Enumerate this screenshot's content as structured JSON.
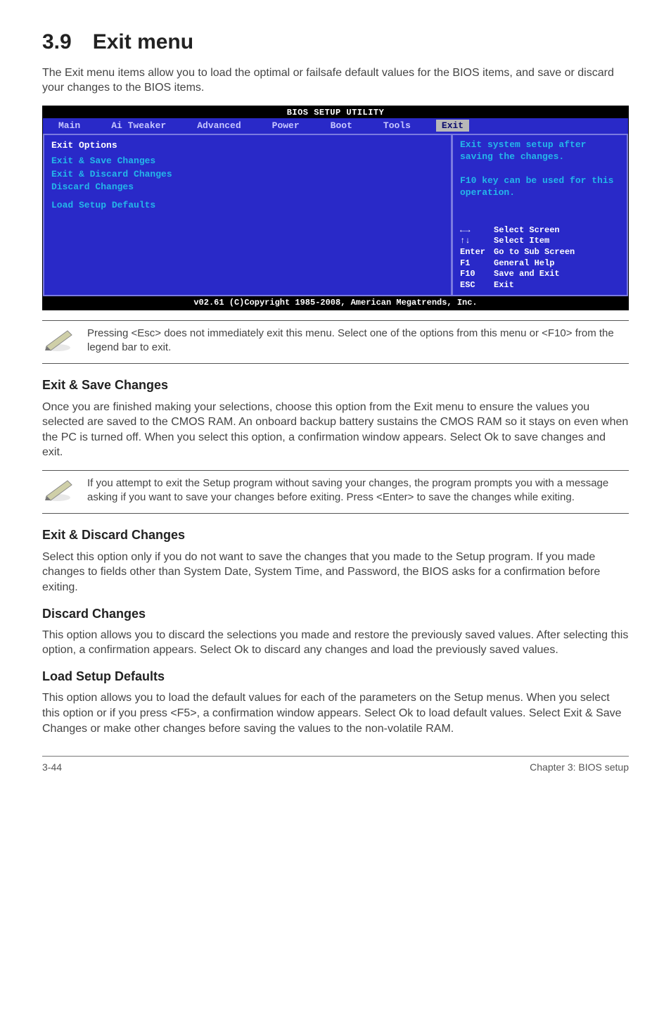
{
  "section": {
    "number": "3.9",
    "title": "Exit menu"
  },
  "intro": "The Exit menu items allow you to load the optimal or failsafe default values for the BIOS items, and save or discard your changes to the BIOS items.",
  "bios": {
    "title": "BIOS SETUP UTILITY",
    "tabs": [
      "Main",
      "Ai Tweaker",
      "Advanced",
      "Power",
      "Boot",
      "Tools",
      "Exit"
    ],
    "active_tab": "Exit",
    "options_header": "Exit Options",
    "options": [
      "Exit & Save Changes",
      "Exit & Discard Changes",
      "Discard Changes",
      "Load Setup Defaults"
    ],
    "help": "Exit system setup after saving the changes.\n\nF10 key can be used for this operation.",
    "keys": [
      {
        "k": "←→",
        "d": "Select Screen"
      },
      {
        "k": "↑↓",
        "d": "Select Item"
      },
      {
        "k": "Enter",
        "d": "Go to Sub Screen"
      },
      {
        "k": "F1",
        "d": "General Help"
      },
      {
        "k": "F10",
        "d": "Save and Exit"
      },
      {
        "k": "ESC",
        "d": "Exit"
      }
    ],
    "footer": "v02.61 (C)Copyright 1985-2008, American Megatrends, Inc."
  },
  "note1": "Pressing <Esc> does not immediately exit this menu. Select one of the options from this menu or <F10> from the legend bar to exit.",
  "sections": {
    "save": {
      "title": "Exit & Save Changes",
      "body": "Once you are finished making your selections, choose this option from the Exit menu to ensure the values you selected are saved to the CMOS RAM. An onboard backup battery sustains the CMOS RAM so it stays on even when the PC is turned off. When you select this option, a confirmation window appears. Select Ok to save changes and exit."
    },
    "note2": "If you attempt to exit the Setup program without saving your changes, the program prompts you with a message asking if you want to save your changes before exiting. Press <Enter> to save the changes while exiting.",
    "discard_exit": {
      "title": "Exit & Discard Changes",
      "body": "Select this option only if you do not want to save the changes that you  made to the Setup program. If you made changes to fields other than System Date, System Time, and Password, the BIOS asks for a confirmation before exiting."
    },
    "discard": {
      "title": "Discard Changes",
      "body": "This option allows you to discard the selections you made and restore the previously saved values. After selecting this option, a confirmation appears. Select Ok to discard any changes and load the previously saved values."
    },
    "load": {
      "title": "Load Setup Defaults",
      "body": "This option allows you to load the default values for each of the parameters on the Setup menus. When you select this option or if you press <F5>, a confirmation window appears. Select Ok to load default values. Select Exit & Save Changes or make other changes before saving the values to the non-volatile RAM."
    }
  },
  "footer": {
    "left": "3-44",
    "right": "Chapter 3: BIOS setup"
  }
}
